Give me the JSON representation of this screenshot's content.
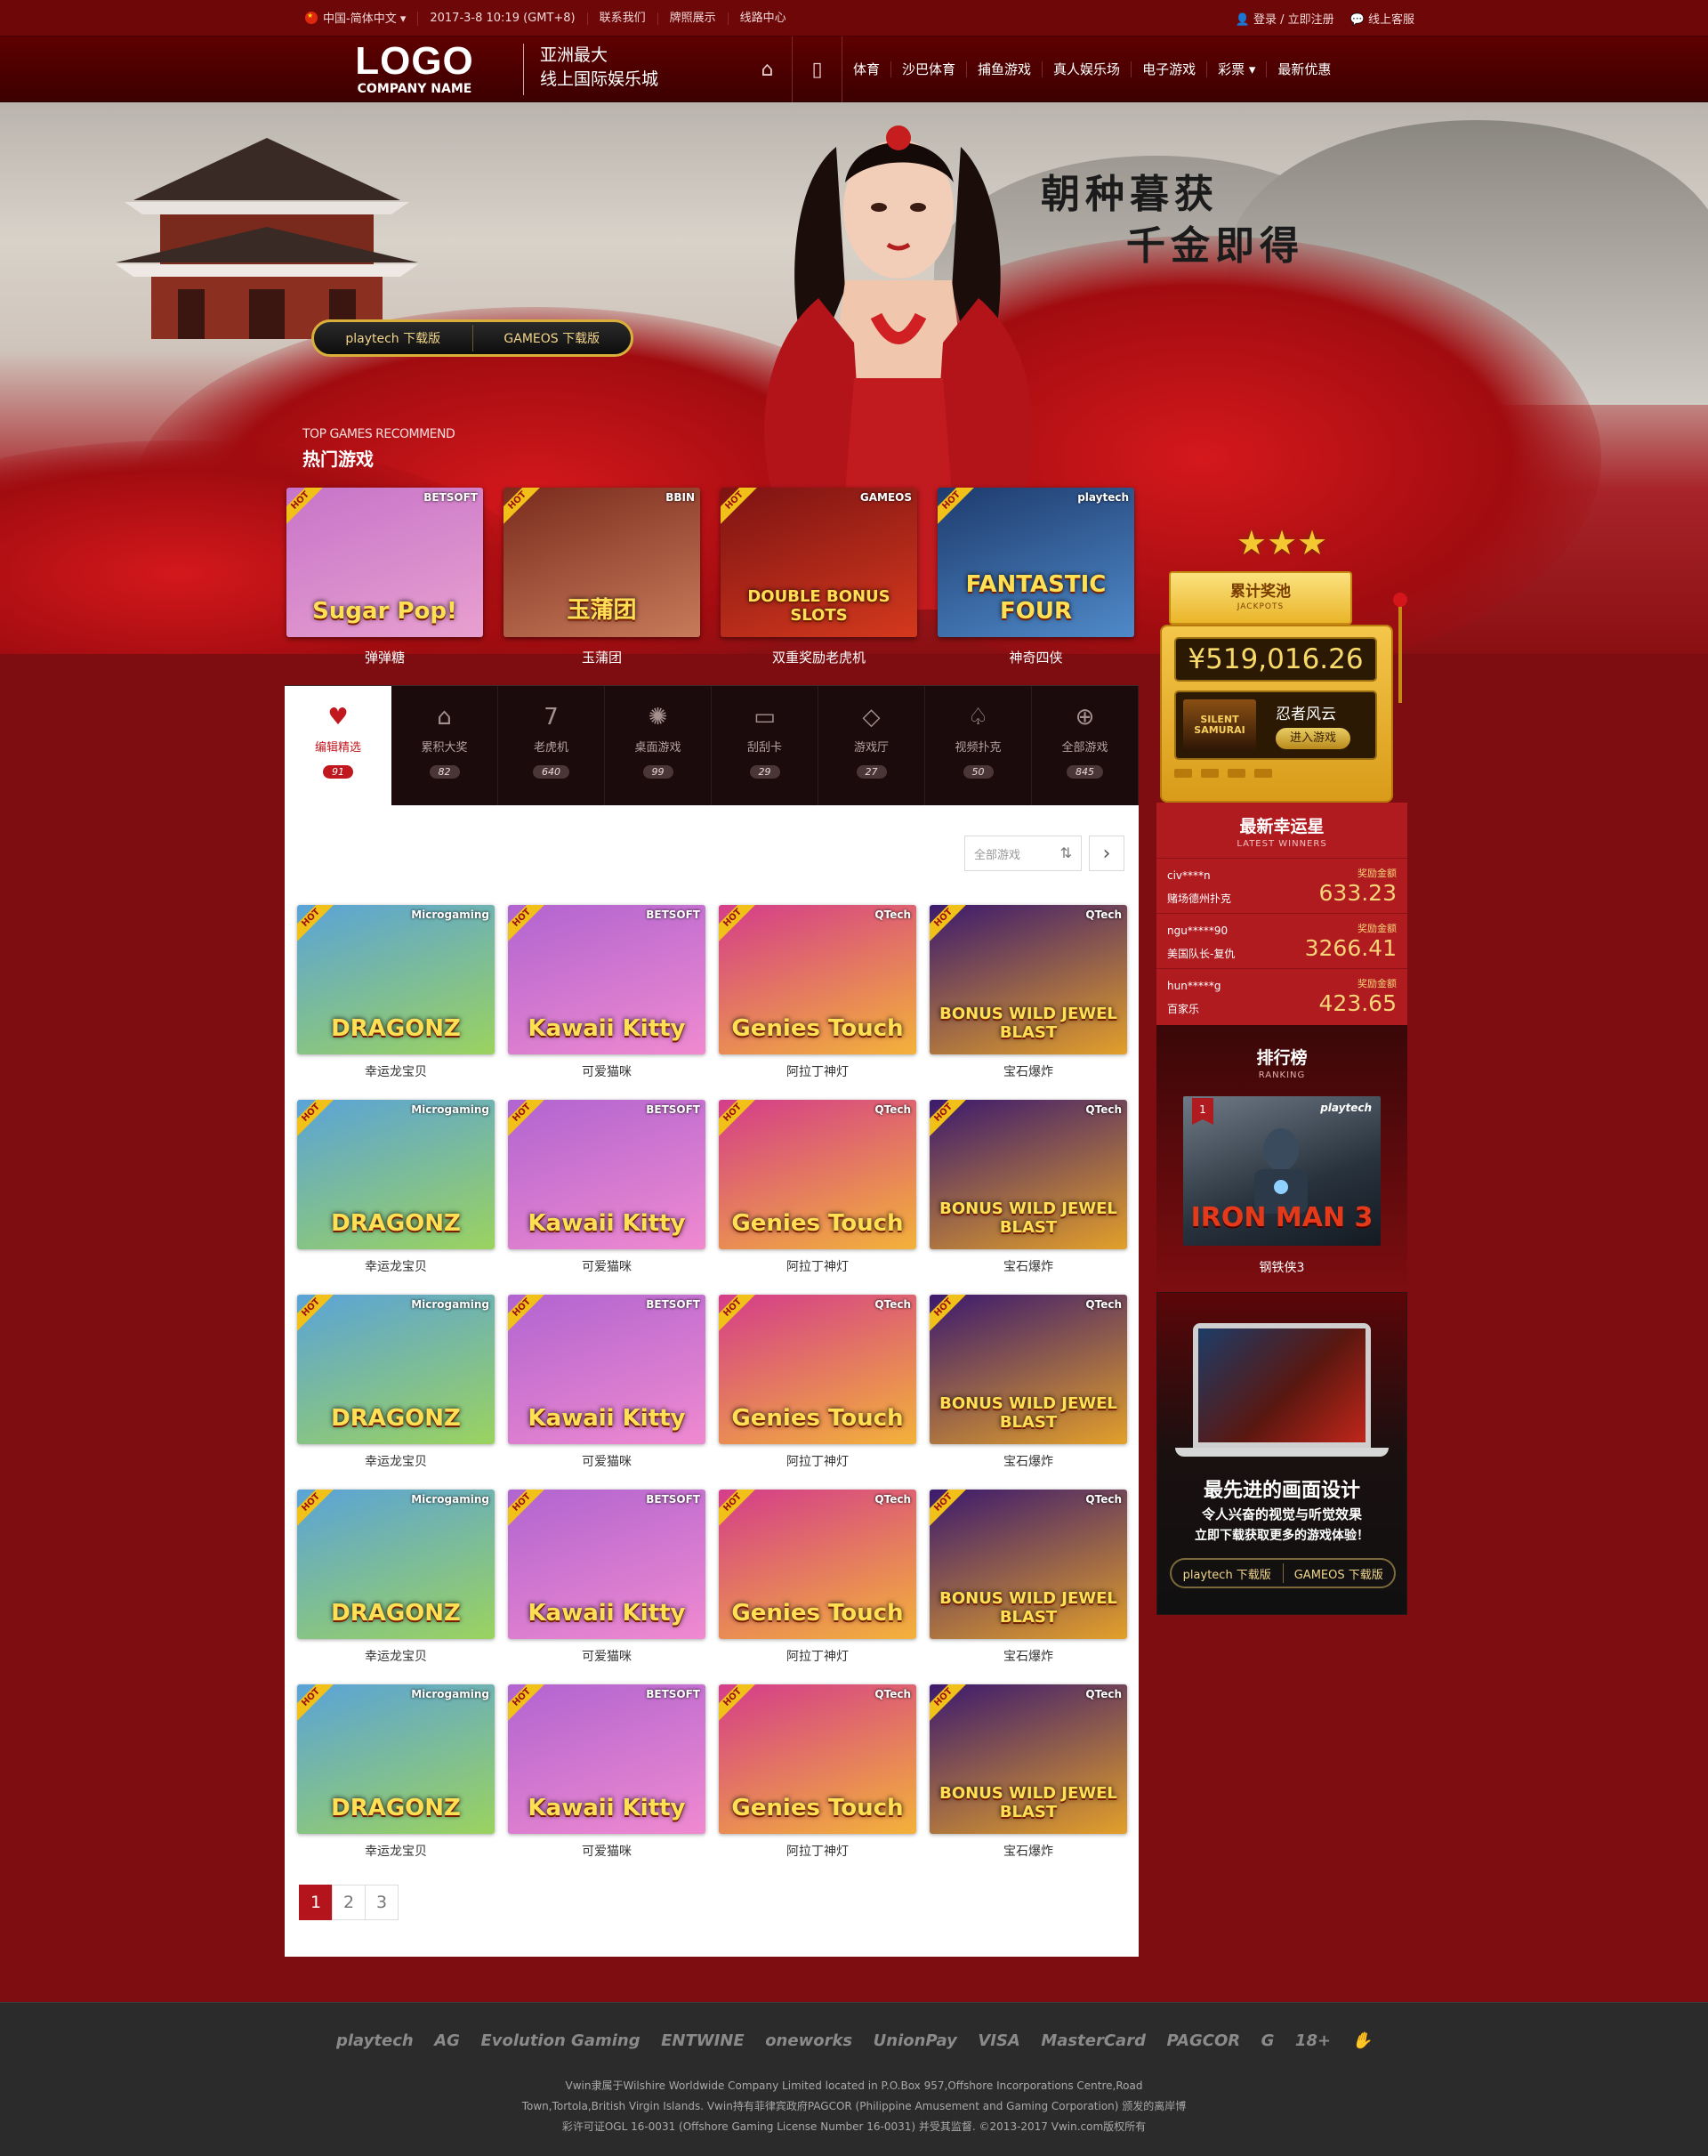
{
  "topbar": {
    "language": "中国-简体中文 ▾",
    "datetime": "2017-3-8 10:19 (GMT+8)",
    "links": [
      "联系我们",
      "牌照展示",
      "线路中心"
    ],
    "login": "登录 / 立即注册",
    "service": "线上客服"
  },
  "header": {
    "logo_main": "LOGO",
    "logo_sub": "COMPANY NAME",
    "slogan_line1": "亚洲最大",
    "slogan_line2": "线上国际娱乐城",
    "nav": [
      "体育",
      "沙巴体育",
      "捕鱼游戏",
      "真人娱乐场",
      "电子游戏",
      "彩票 ▾",
      "最新优惠"
    ]
  },
  "hero": {
    "calligraphy_line1": "朝种暮获",
    "calligraphy_line2": "千金即得",
    "download_buttons": [
      "playtech 下载版",
      "GAMEOS 下载版"
    ]
  },
  "top_games": {
    "title_en": "TOP GAMES RECOMMEND",
    "title_cn": "热门游戏",
    "items": [
      {
        "name": "弹弹糖",
        "thumb_text": "Sugar Pop!",
        "brand": "BETSOFT",
        "hot": "HOT",
        "color1": "#c774c9",
        "color2": "#e8a0cf"
      },
      {
        "name": "玉蒲团",
        "thumb_text": "玉蒲团",
        "brand": "BBIN",
        "hot": "HOT",
        "color1": "#7a2b1d",
        "color2": "#c87b5a"
      },
      {
        "name": "双重奖励老虎机",
        "thumb_text": "DOUBLE BONUS SLOTS",
        "brand": "GAMEOS",
        "hot": "HOT",
        "color1": "#7d1313",
        "color2": "#d4391d"
      },
      {
        "name": "神奇四侠",
        "thumb_text": "FANTASTIC FOUR",
        "brand": "playtech",
        "hot": "HOT",
        "color1": "#1e3b6e",
        "color2": "#4f8ac9"
      }
    ]
  },
  "tabs": [
    {
      "label": "编辑精选",
      "count": "91",
      "icon": "heart-icon",
      "glyph": "♥"
    },
    {
      "label": "累积大奖",
      "count": "82",
      "icon": "gift-icon",
      "glyph": "⌂"
    },
    {
      "label": "老虎机",
      "count": "640",
      "icon": "seven-icon",
      "glyph": "7"
    },
    {
      "label": "桌面游戏",
      "count": "99",
      "icon": "chip-icon",
      "glyph": "✺"
    },
    {
      "label": "刮刮卡",
      "count": "29",
      "icon": "ticket-icon",
      "glyph": "▭"
    },
    {
      "label": "游戏厅",
      "count": "27",
      "icon": "diamond-icon",
      "glyph": "◇"
    },
    {
      "label": "视频扑克",
      "count": "50",
      "icon": "spade-icon",
      "glyph": "♤"
    },
    {
      "label": "全部游戏",
      "count": "845",
      "icon": "gamepad-icon",
      "glyph": "⊕"
    }
  ],
  "panel": {
    "filter_placeholder": "全部游戏",
    "games": [
      {
        "name": "幸运龙宝贝",
        "thumb_text": "DRAGONZ",
        "brand": "Microgaming",
        "hot": "HOT",
        "color1": "#5aa3d8",
        "color2": "#9bd35f"
      },
      {
        "name": "可爱猫咪",
        "thumb_text": "Kawaii Kitty",
        "brand": "BETSOFT",
        "hot": "HOT",
        "color1": "#b164d0",
        "color2": "#f08ad0"
      },
      {
        "name": "阿拉丁神灯",
        "thumb_text": "Genies Touch",
        "brand": "QTech",
        "hot": "HOT",
        "color1": "#d43d8a",
        "color2": "#f3b23a"
      },
      {
        "name": "宝石爆炸",
        "thumb_text": "BONUS WILD JEWEL BLAST",
        "brand": "QTech",
        "hot": "HOT",
        "color1": "#3c1a6e",
        "color2": "#e3a02a"
      }
    ],
    "pages": [
      "1",
      "2",
      "3"
    ]
  },
  "jackpot": {
    "title": "累计奖池",
    "title_en": "JACKPOTS",
    "amount": "¥519,016.26",
    "game_name": "忍者风云",
    "game_thumb": "SILENT SAMURAI",
    "enter": "进入游戏"
  },
  "winners": {
    "title": "最新幸运星",
    "title_en": "LATEST WINNERS",
    "label": "奖励金额",
    "rows": [
      {
        "user": "civ****n",
        "game": "赌场德州扑克",
        "amount": "633.23"
      },
      {
        "user": "ngu*****90",
        "game": "美国队长-复仇",
        "amount": "3266.41"
      },
      {
        "user": "hun*****g",
        "game": "百家乐",
        "amount": "423.65"
      }
    ]
  },
  "ranking": {
    "title": "排行榜",
    "title_en": "RANKING",
    "rank": "1",
    "brand": "playtech",
    "thumb_text": "IRON MAN 3",
    "name": "钢铁侠3"
  },
  "promo": {
    "line1": "最先进的画面设计",
    "line2": "令人兴奋的视觉与听觉效果",
    "line3": "立即下载获取更多的游戏体验！",
    "buttons": [
      "playtech 下载版",
      "GAMEOS 下载版"
    ]
  },
  "footer": {
    "logos": [
      "playtech",
      "AG",
      "Evolution Gaming",
      "ENTWINE",
      "oneworks",
      "UnionPay",
      "VISA",
      "MasterCard",
      "PAGCOR",
      "G",
      "18+",
      "✋"
    ],
    "copy1": "Vwin隶属于Wilshire Worldwide Company Limited located in P.O.Box 957,Offshore Incorporations Centre,Road",
    "copy2": "Town,Tortola,British Virgin Islands. Vwin持有菲律宾政府PAGCOR (Philippine Amusement and Gaming Corporation) 颁发的离岸博",
    "copy3": "彩许可证OGL 16-0031 (Offshore Gaming License Number 16-0031) 并受其监督. ©2013-2017 Vwin.com版权所有"
  },
  "colors": {
    "brand_red": "#b4151c",
    "dark_red": "#7d0d10",
    "gold": "#f7d478"
  }
}
